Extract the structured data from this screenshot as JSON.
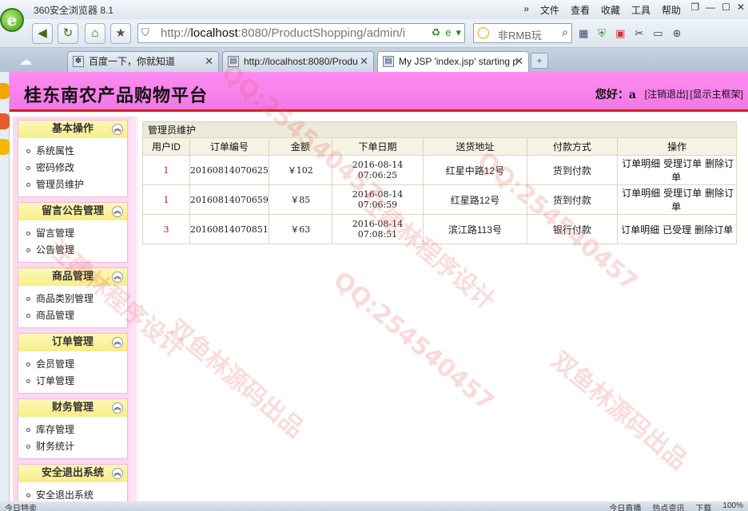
{
  "browser": {
    "window_title": "360安全浏览器 8.1",
    "menus": [
      "»",
      "文件",
      "查看",
      "收藏",
      "工具",
      "帮助"
    ],
    "window_buttons": [
      "❐",
      "—",
      "☐",
      "✕"
    ],
    "url_host": "http://",
    "url_bold": "localhost",
    "url_rest": ":8080/ProductShopping/admin/i",
    "search_text": "非RMB玩",
    "tabs": [
      {
        "label": "百度一下，你就知道",
        "icon": "paw-icon"
      },
      {
        "label": "http://localhost:8080/Produ",
        "icon": "page-icon"
      },
      {
        "label": "My JSP 'index.jsp' starting p",
        "icon": "page-icon"
      }
    ],
    "status_left": "今日特卖",
    "status_right": [
      "今日直播",
      "热点资讯",
      "下载",
      "100%"
    ]
  },
  "header": {
    "site_title": "桂东南农产品购物平台",
    "greeting": "您好：a",
    "logout_link": "[注销退出]",
    "frame_link": "[显示主框架]"
  },
  "sidebar": {
    "sections": [
      {
        "title": "基本操作",
        "items": [
          "系统属性",
          "密码修改",
          "管理员维护"
        ]
      },
      {
        "title": "留言公告管理",
        "items": [
          "留言管理",
          "公告管理"
        ]
      },
      {
        "title": "商品管理",
        "items": [
          "商品类别管理",
          "商品管理"
        ]
      },
      {
        "title": "订单管理",
        "items": [
          "会员管理",
          "订单管理"
        ]
      },
      {
        "title": "财务管理",
        "items": [
          "库存管理",
          "财务统计"
        ]
      },
      {
        "title": "安全退出系统",
        "items": [
          "安全退出系统"
        ]
      }
    ]
  },
  "main": {
    "panel_title": "管理员维护",
    "columns": [
      "用户ID",
      "订单编号",
      "金额",
      "下单日期",
      "送货地址",
      "付款方式",
      "操作"
    ],
    "rows": [
      {
        "uid": "1",
        "order_no": "20160814070625",
        "amount": "￥102",
        "date": "2016-08-14 07:06:25",
        "address": "红星中路12号",
        "payment": "货到付款",
        "actions": [
          "订单明细",
          "受理订单",
          "删除订单"
        ]
      },
      {
        "uid": "1",
        "order_no": "20160814070659",
        "amount": "￥85",
        "date": "2016-08-14 07:06:59",
        "address": "红星路12号",
        "payment": "货到付款",
        "actions": [
          "订单明细",
          "受理订单",
          "删除订单"
        ]
      },
      {
        "uid": "3",
        "order_no": "20160814070851",
        "amount": "￥63",
        "date": "2016-08-14 07:08:51",
        "address": "滨江路113号",
        "payment": "银行付款",
        "actions": [
          "订单明细",
          "已受理",
          "删除订单"
        ]
      }
    ]
  },
  "watermark": {
    "texts": [
      "QQ:254540457",
      "汪建林程序设计",
      "双鱼林源码出品"
    ]
  }
}
